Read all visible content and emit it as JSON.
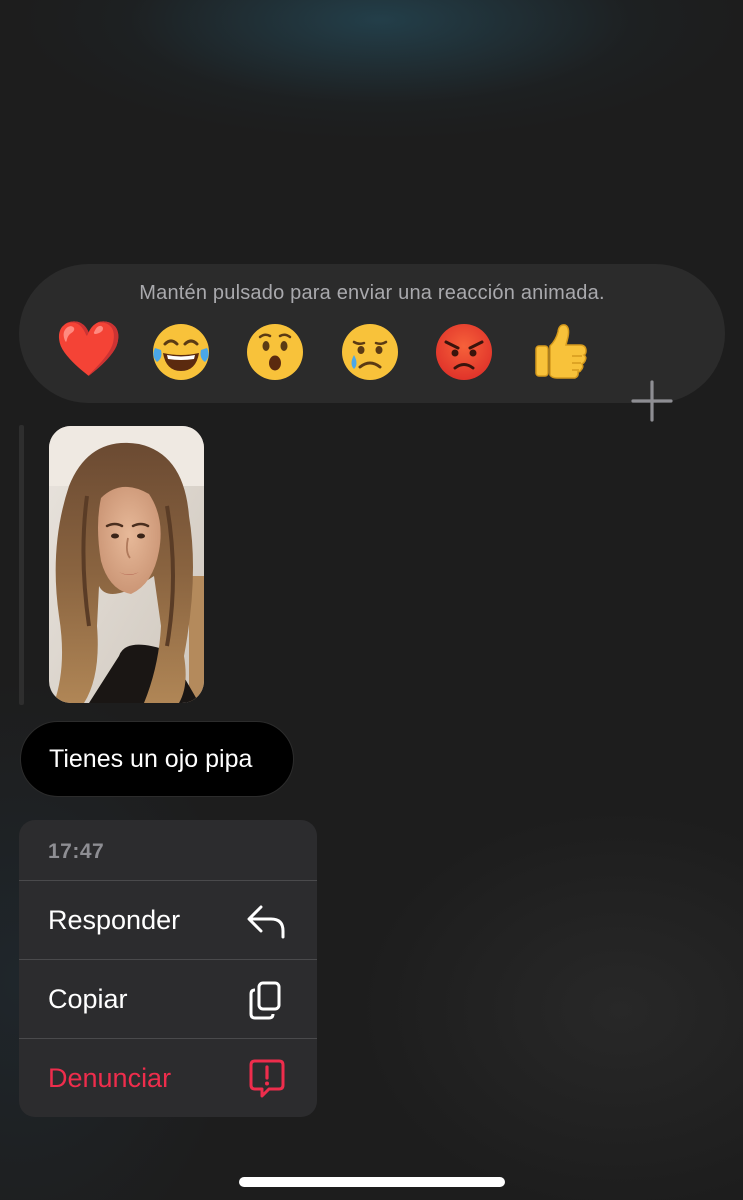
{
  "reactions": {
    "hint": "Mantén pulsado para enviar una reacción animada.",
    "emojis": [
      "❤️",
      "😂",
      "😮",
      "😢",
      "😡",
      "👍"
    ],
    "more_icon": "plus-icon"
  },
  "message": {
    "photo_icon": "photo-attachment",
    "text": "Tienes un ojo pipa"
  },
  "context_menu": {
    "time": "17:47",
    "items": [
      {
        "label": "Responder",
        "icon": "reply-icon"
      },
      {
        "label": "Copiar",
        "icon": "copy-icon"
      },
      {
        "label": "Denunciar",
        "icon": "report-icon",
        "color": "#ee2d4c"
      }
    ]
  },
  "colors": {
    "danger": "#ee2d4c",
    "menu_bg": "#2c2c2e",
    "bubble_bg": "#000000"
  }
}
